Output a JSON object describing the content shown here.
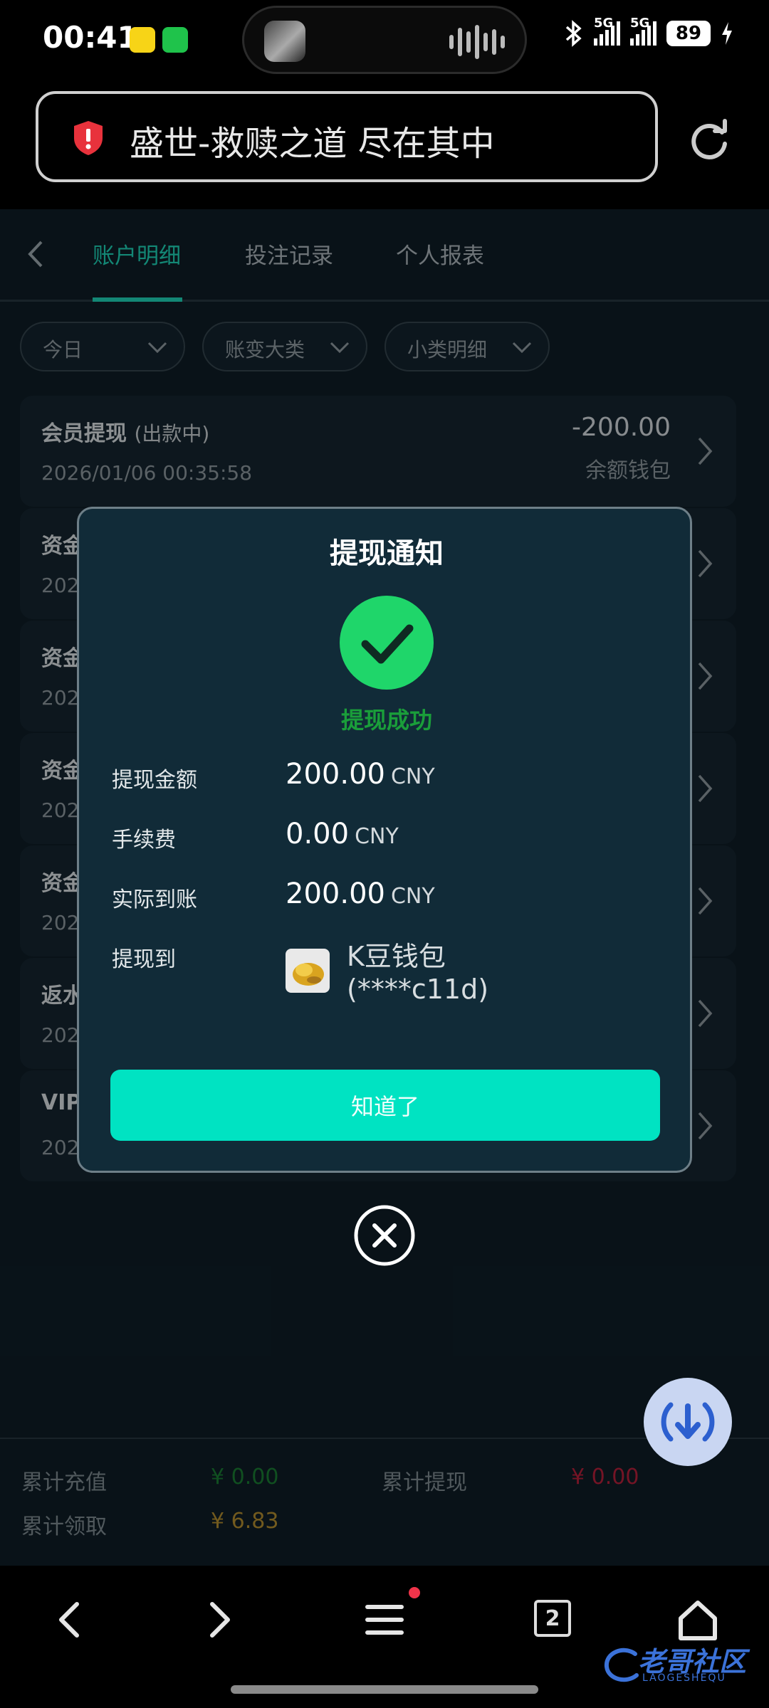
{
  "status_bar": {
    "time": "00:41",
    "network_1": "5G",
    "network_2": "5G",
    "battery": "89"
  },
  "url_bar": {
    "text": "盛世-救赎之道 尽在其中"
  },
  "tabs": [
    {
      "label": "账户明细",
      "active": true
    },
    {
      "label": "投注记录",
      "active": false
    },
    {
      "label": "个人报表",
      "active": false
    }
  ],
  "filters": [
    {
      "label": "今日"
    },
    {
      "label": "账变大类"
    },
    {
      "label": "小类明细"
    }
  ],
  "records": [
    {
      "title": "会员提现",
      "status": "(出款中)",
      "date": "2026/01/06 00:35:58",
      "amount": "-200.00",
      "wallet": "余额钱包"
    },
    {
      "title": "资金",
      "date": "202"
    },
    {
      "title": "资金",
      "date": "202"
    },
    {
      "title": "资金",
      "date": "202"
    },
    {
      "title": "资金",
      "date": "202"
    },
    {
      "title": "返水",
      "date": "202"
    },
    {
      "title": "VIP",
      "date": "202"
    }
  ],
  "summary": {
    "total_recharge_label": "累计充值",
    "total_recharge_value": "¥ 0.00",
    "total_withdraw_label": "累计提现",
    "total_withdraw_value": "¥ 0.00",
    "total_claim_label": "累计领取",
    "total_claim_value": "¥ 6.83"
  },
  "dialog": {
    "title": "提现通知",
    "success": "提现成功",
    "amount_label": "提现金额",
    "amount_value": "200.00",
    "amount_currency": "CNY",
    "fee_label": "手续费",
    "fee_value": "0.00",
    "fee_currency": "CNY",
    "actual_label": "实际到账",
    "actual_value": "200.00",
    "actual_currency": "CNY",
    "to_label": "提现到",
    "to_wallet_name": "K豆钱包",
    "to_wallet_account": "(****c11d)",
    "ok_button": "知道了"
  },
  "navbar": {
    "tab_count": "2"
  },
  "watermark": {
    "text": "老哥社区",
    "sub": "LAOGESHEQU"
  },
  "colors": {
    "accent": "#1ed0b4",
    "button": "#00e3c2",
    "success": "#1fd66a",
    "negative": "#e0304a",
    "gold": "#d4a23a"
  }
}
